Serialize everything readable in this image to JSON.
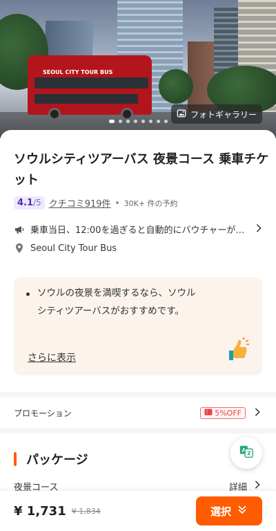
{
  "hero": {
    "bus_sign": "SEOUL CITY TOUR BUS",
    "gallery_label": "フォトギャラリー",
    "gallery_icon": "image-icon",
    "pager_total": 8,
    "pager_active": 1
  },
  "product": {
    "title": "ソウルシティツアーバス 夜景コース 乗車チケット",
    "rating": "4.1",
    "rating_max": "/5",
    "reviews": "クチコミ919件",
    "separator": "•",
    "bookings": "30K+ 件の予約",
    "notice": "乗車当日、12:00を過ぎると自動的にバウチャーが…",
    "location": "Seoul City Tour Bus"
  },
  "highlight": {
    "text": "ソウルの夜景を満喫するなら、ソウルシティツアーバスがおすすめです。",
    "more": "さらに表示"
  },
  "promo": {
    "label": "プロモーション",
    "badge": "5%OFF"
  },
  "package": {
    "heading": "パッケージ",
    "option": "夜景コース",
    "detail": "詳細"
  },
  "bottom": {
    "price": "¥ 1,731",
    "old_price": "¥ 1,834",
    "select": "選択"
  },
  "colors": {
    "accent": "#ff5b00",
    "rating_bg": "#eee9ff",
    "rating_text": "#4b2fa8",
    "promo": "#e84141",
    "highlight_bg": "#fbf3ec"
  }
}
